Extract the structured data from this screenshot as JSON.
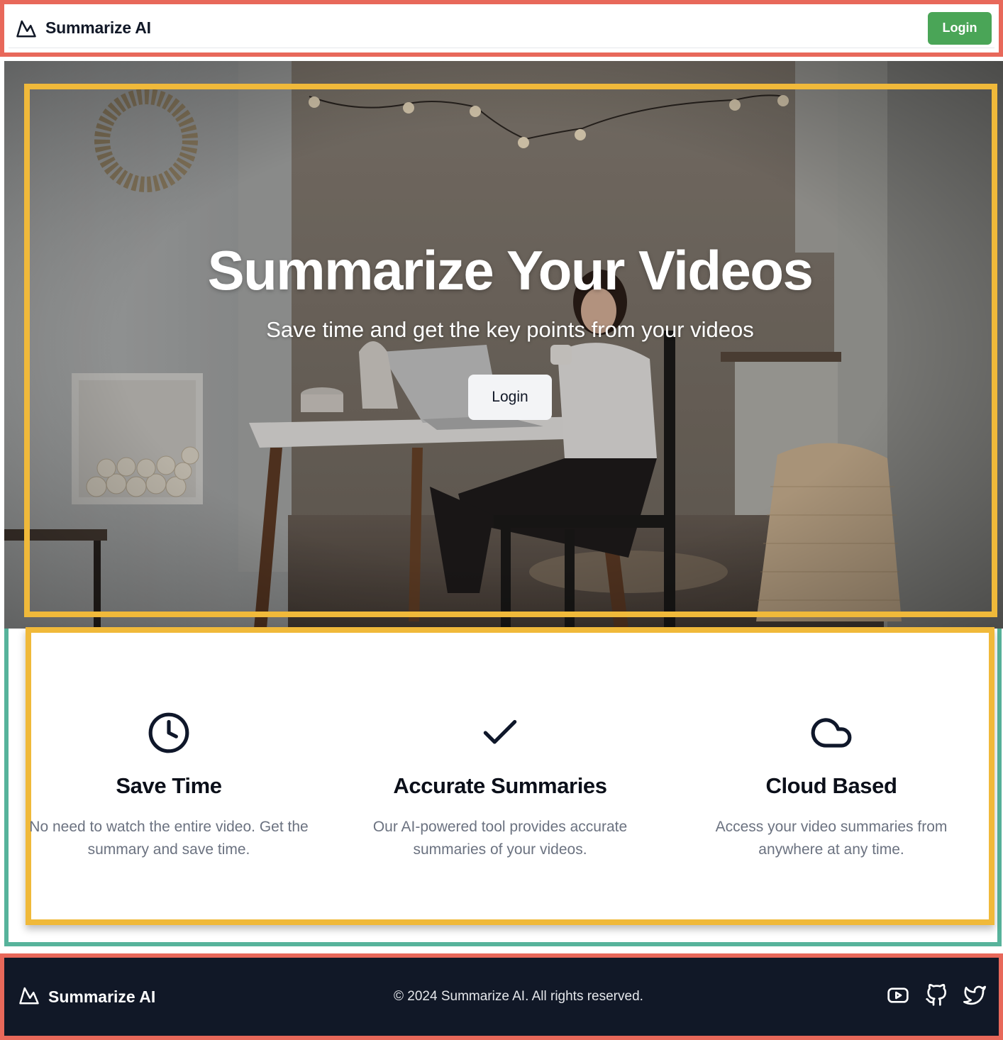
{
  "header": {
    "brand_name": "Summarize AI",
    "login_label": "Login"
  },
  "hero": {
    "title": "Summarize Your Videos",
    "subtitle": "Save time and get the key points from your videos",
    "login_label": "Login"
  },
  "features": [
    {
      "icon": "clock-icon",
      "title": "Save Time",
      "description": "No need to watch the entire video. Get the summary and save time."
    },
    {
      "icon": "check-icon",
      "title": "Accurate Summaries",
      "description": "Our AI-powered tool provides accurate summaries of your videos."
    },
    {
      "icon": "cloud-icon",
      "title": "Cloud Based",
      "description": "Access your video summaries from anywhere at any time."
    }
  ],
  "footer": {
    "brand_name": "Summarize AI",
    "copyright": "© 2024 Summarize AI. All rights reserved.",
    "social": [
      "youtube-icon",
      "github-icon",
      "twitter-icon"
    ]
  },
  "colors": {
    "header_login_bg": "#4aa557",
    "footer_bg": "#111827",
    "frame_red": "#e8685a",
    "frame_teal": "#57b39b",
    "frame_yellow": "#f0b93a"
  }
}
